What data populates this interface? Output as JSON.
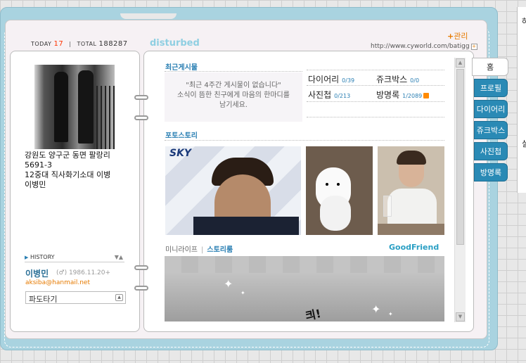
{
  "counter": {
    "today_label": "TODAY",
    "today_value": "17",
    "total_label": "TOTAL",
    "total_value": "188287"
  },
  "homepage_title": "disturbed",
  "header": {
    "edit_label": "관리",
    "edit_plus": "+",
    "url": "http://www.cyworld.com/batigg",
    "url_plus": "+"
  },
  "profile": {
    "text_lines": [
      "강원도 양구군 동면 팔랑리 5691-3",
      "12중대 직사화기소대 이병",
      "이병민"
    ],
    "history_label": "HISTORY",
    "history_ctrl": "▼▲",
    "name": "이병민",
    "meta": "(♂) 1986.11.20+",
    "email": "aksiba@hanmail.net",
    "surf_select": "파도타기"
  },
  "recent": {
    "title": "최근게시물",
    "empty_message_1": "\"최근 4주간 게시물이 없습니다\"",
    "empty_message_2": "소식이 뜸한 친구에게 마음의 한마디를",
    "empty_message_3": "남기세요."
  },
  "menu_counts": [
    {
      "label": "다이어리",
      "count": "0/39"
    },
    {
      "label": "쥬크박스",
      "count": "0/0"
    },
    {
      "label": "사진첩",
      "count": "0/213"
    },
    {
      "label": "방명록",
      "count": "1/2089"
    }
  ],
  "photostory": {
    "title": "포토스토리",
    "sky_text": "SKY"
  },
  "miniroom": {
    "tab_minilife": "미니라이프",
    "tab_separator": "|",
    "tab_storyroom": "스토리룸",
    "goodfriend": "GoodFriend",
    "doodle_text": "킈!"
  },
  "tabs": [
    "홈",
    "프로필",
    "다이어리",
    "쥬크박스",
    "사진첩",
    "방명록"
  ],
  "side_panel": {
    "glyph_top": "하",
    "glyph_mid": "실"
  },
  "colors": {
    "frame": "#a9d3e0",
    "accent_blue": "#2a7fb3",
    "tab_blue": "#2a8ab5",
    "orange": "#e67a00",
    "today_red": "#ff3300"
  },
  "icons": [
    "rss-icon",
    "scroll-up-icon",
    "scroll-down-icon",
    "dropdown-icon",
    "history-arrow-icon",
    "star-icon"
  ]
}
